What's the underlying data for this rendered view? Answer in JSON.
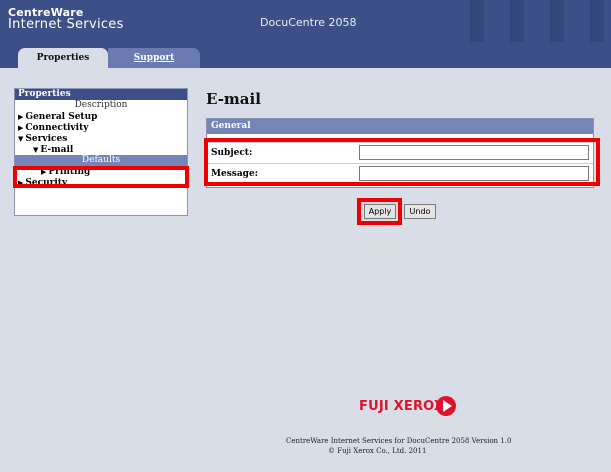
{
  "header": {
    "brand_line1": "CentreWare",
    "brand_line2": "Internet Services",
    "model": "DocuCentre 2058"
  },
  "tabs": [
    {
      "label": "Properties",
      "active": true
    },
    {
      "label": "Support",
      "active": false
    }
  ],
  "sidebar": {
    "heading": "Properties",
    "items": [
      {
        "label": "Description"
      },
      {
        "label": "General Setup",
        "icon": "triangle-right-icon"
      },
      {
        "label": "Connectivity",
        "icon": "triangle-right-icon"
      },
      {
        "label": "Services",
        "icon": "triangle-down-icon"
      },
      {
        "label": "E-mail",
        "icon": "triangle-down-icon"
      },
      {
        "label": "Defaults",
        "selected": true
      },
      {
        "label": "Printing",
        "icon": "triangle-right-icon"
      },
      {
        "label": "Security",
        "icon": "triangle-right-icon"
      }
    ]
  },
  "main": {
    "title": "E-mail",
    "group_title": "General",
    "fields": [
      {
        "label": "Subject:",
        "value": ""
      },
      {
        "label": "Message:",
        "value": ""
      }
    ],
    "apply_label": "Apply",
    "undo_label": "Undo"
  },
  "footer": {
    "logo_text": "FUJI XEROX",
    "line1": "CentreWare Internet Services for DocuCentre 2058 Version 1.0",
    "line2": "© Fuji Xerox Co., Ltd. 2011"
  },
  "colors": {
    "header_bg": "#3c4f86",
    "page_bg": "#d9dde8",
    "highlight": "#ee0000",
    "logo": "#e0112b"
  }
}
